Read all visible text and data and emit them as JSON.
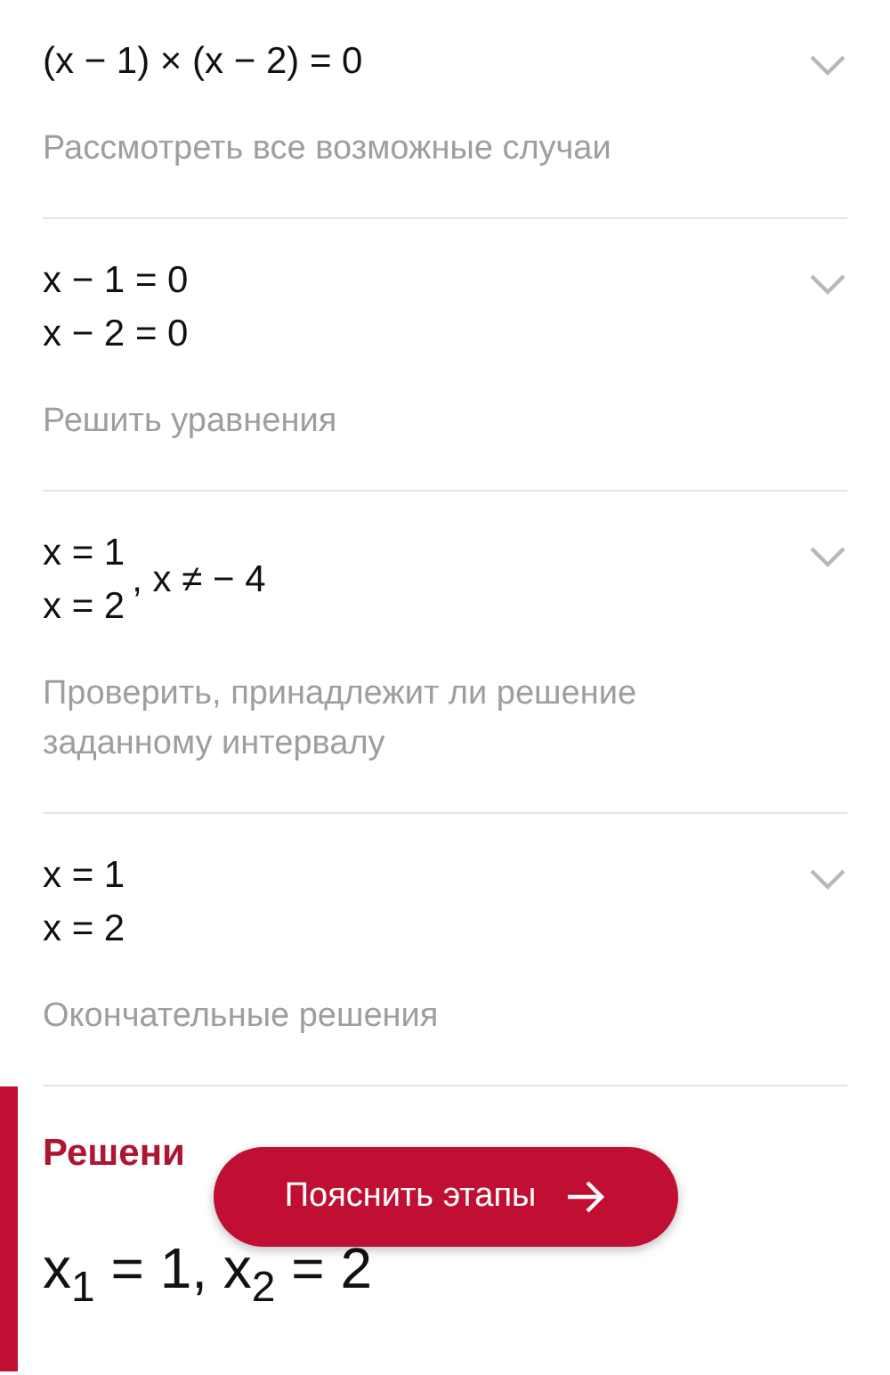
{
  "steps": [
    {
      "lines": [
        "(x − 1) × (x − 2) = 0"
      ],
      "explanation": "Рассмотреть все возможные случаи",
      "expanded": false
    },
    {
      "lines": [
        "x − 1 = 0",
        "x − 2 = 0"
      ],
      "explanation": "Решить уравнения",
      "expanded": false
    },
    {
      "lines": [
        "x = 1",
        "x = 2"
      ],
      "condition": ", x ≠ − 4",
      "explanation": "Проверить, принадлежит ли решение заданному интервалу",
      "expanded": false
    },
    {
      "lines": [
        "x = 1",
        "x = 2"
      ],
      "explanation": "Окончательные решения",
      "expanded": false
    }
  ],
  "solution": {
    "title": "Решени",
    "answer": "x$_{1}$ = 1, x$_{2}$ = 2"
  },
  "explain_button": {
    "label": "Пояснить этапы"
  }
}
